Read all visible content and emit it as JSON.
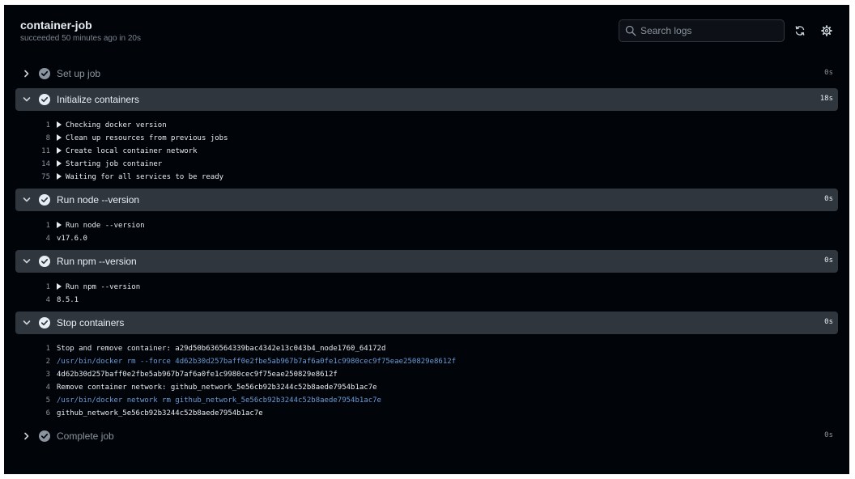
{
  "header": {
    "title": "container-job",
    "subtitle": "succeeded 50 minutes ago in 20s",
    "search_placeholder": "Search logs"
  },
  "colors": {
    "background": "#010409",
    "expanded_step_bg": "#30363d",
    "text": "#e6edf3",
    "muted": "#8b949e",
    "command_text": "#6a9bd8",
    "check_icon": "#8b949e"
  },
  "steps": [
    {
      "name": "Set up job",
      "duration": "0s",
      "expanded": false,
      "lines": []
    },
    {
      "name": "Initialize containers",
      "duration": "18s",
      "expanded": true,
      "lines": [
        {
          "num": "1",
          "text": "Checking docker version",
          "group": true
        },
        {
          "num": "8",
          "text": "Clean up resources from previous jobs",
          "group": true
        },
        {
          "num": "11",
          "text": "Create local container network",
          "group": true
        },
        {
          "num": "14",
          "text": "Starting job container",
          "group": true
        },
        {
          "num": "75",
          "text": "Waiting for all services to be ready",
          "group": true
        }
      ]
    },
    {
      "name": "Run node --version",
      "duration": "0s",
      "expanded": true,
      "lines": [
        {
          "num": "1",
          "text": "Run node --version",
          "group": true
        },
        {
          "num": "4",
          "text": "v17.6.0"
        }
      ]
    },
    {
      "name": "Run npm --version",
      "duration": "0s",
      "expanded": true,
      "lines": [
        {
          "num": "1",
          "text": "Run npm --version",
          "group": true
        },
        {
          "num": "4",
          "text": "8.5.1"
        }
      ]
    },
    {
      "name": "Stop containers",
      "duration": "0s",
      "expanded": true,
      "lines": [
        {
          "num": "1",
          "text": "Stop and remove container: a29d50b636564339bac4342e13c043b4_node1760_64172d"
        },
        {
          "num": "2",
          "text": "/usr/bin/docker rm --force 4d62b30d257baff0e2fbe5ab967b7af6a0fe1c9980cec9f75eae250829e8612f",
          "command": true
        },
        {
          "num": "3",
          "text": "4d62b30d257baff0e2fbe5ab967b7af6a0fe1c9980cec9f75eae250829e8612f"
        },
        {
          "num": "4",
          "text": "Remove container network: github_network_5e56cb92b3244c52b8aede7954b1ac7e"
        },
        {
          "num": "5",
          "text": "/usr/bin/docker network rm github_network_5e56cb92b3244c52b8aede7954b1ac7e",
          "command": true
        },
        {
          "num": "6",
          "text": "github_network_5e56cb92b3244c52b8aede7954b1ac7e"
        }
      ]
    },
    {
      "name": "Complete job",
      "duration": "0s",
      "expanded": false,
      "lines": []
    }
  ]
}
